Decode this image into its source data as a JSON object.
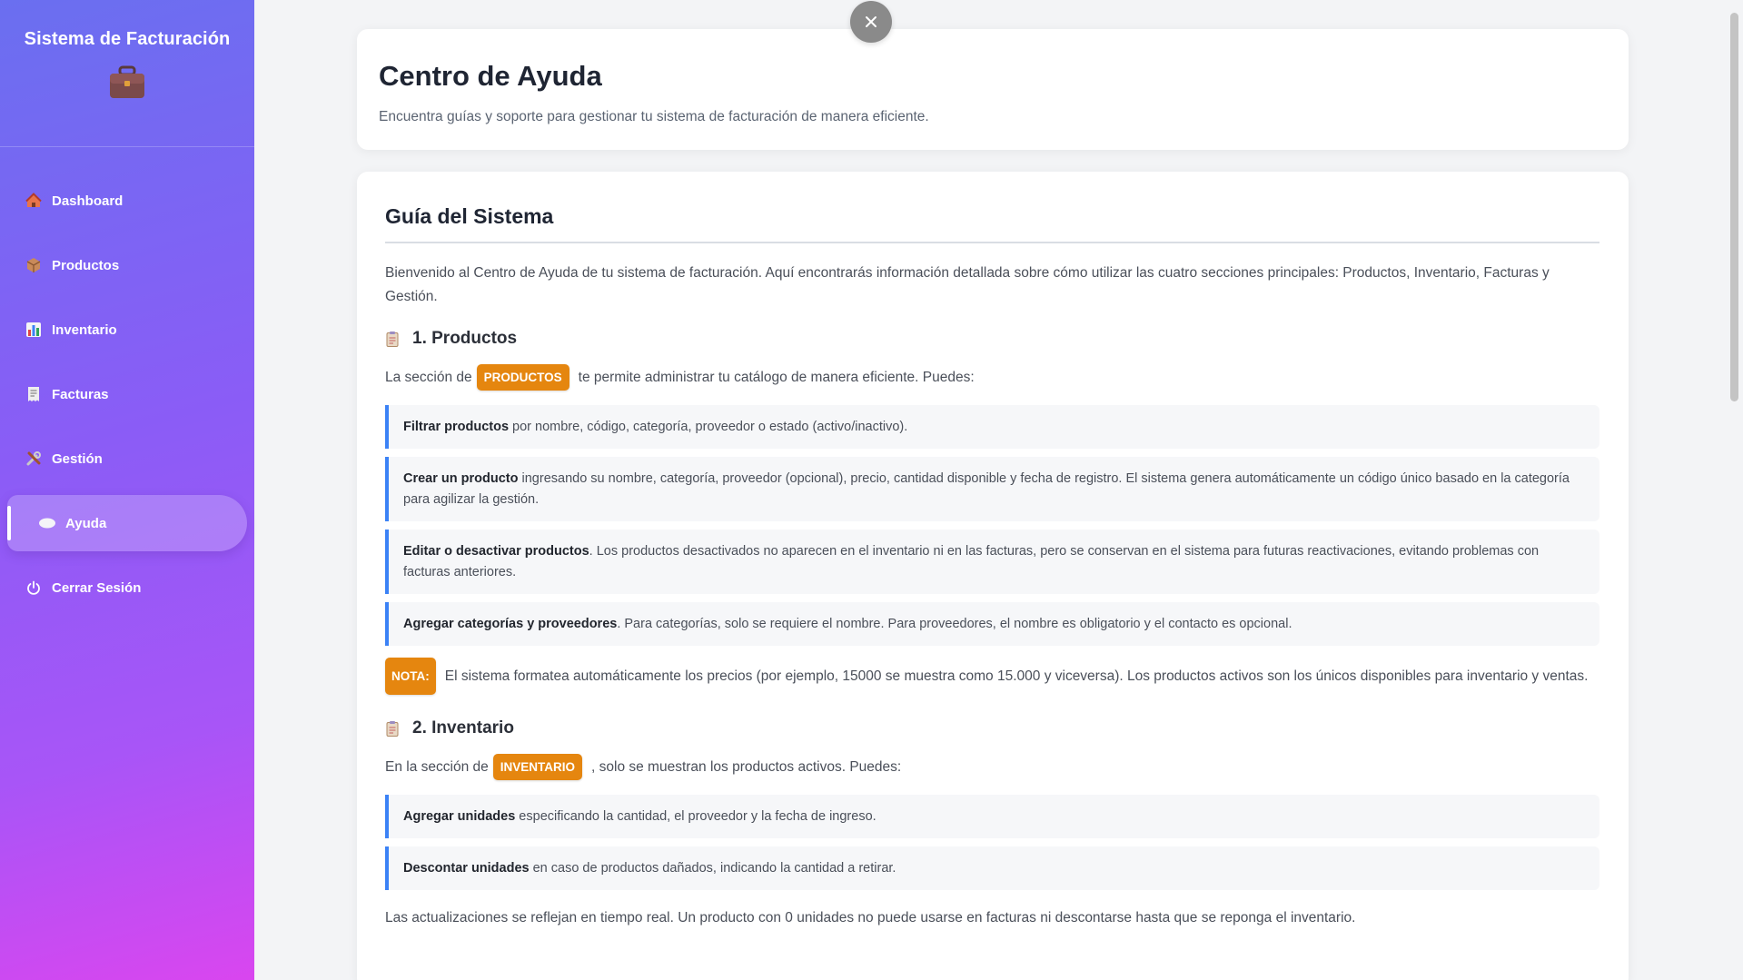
{
  "sidebar": {
    "brand": "Sistema de Facturación",
    "brand_icon": "briefcase-icon",
    "items": [
      {
        "label": "Dashboard",
        "icon": "house-icon"
      },
      {
        "label": "Productos",
        "icon": "package-icon"
      },
      {
        "label": "Inventario",
        "icon": "bar-chart-icon"
      },
      {
        "label": "Facturas",
        "icon": "receipt-icon"
      },
      {
        "label": "Gestión",
        "icon": "tools-icon"
      },
      {
        "label": "Ayuda",
        "icon": "help-bubble-icon",
        "active": true
      },
      {
        "label": "Cerrar Sesión",
        "icon": "power-icon"
      }
    ]
  },
  "header": {
    "title": "Centro de Ayuda",
    "subtitle": "Encuentra guías y soporte para gestionar tu sistema de facturación de manera eficiente."
  },
  "guide": {
    "title": "Guía del Sistema",
    "intro": "Bienvenido al Centro de Ayuda de tu sistema de facturación. Aquí encontrarás información detallada sobre cómo utilizar las cuatro secciones principales: Productos, Inventario, Facturas y Gestión.",
    "productos": {
      "heading": "1. Productos",
      "lead_before": "La sección de",
      "tag": "PRODUCTOS",
      "lead_after": "te permite administrar tu catálogo de manera eficiente. Puedes:",
      "items": [
        {
          "bold": "Filtrar productos",
          "text": " por nombre, código, categoría, proveedor o estado (activo/inactivo)."
        },
        {
          "bold": "Crear un producto",
          "text": " ingresando su nombre, categoría, proveedor (opcional), precio, cantidad disponible y fecha de registro. El sistema genera automáticamente un código único basado en la categoría para agilizar la gestión."
        },
        {
          "bold": "Editar o desactivar productos",
          "text": ". Los productos desactivados no aparecen en el inventario ni en las facturas, pero se conservan en el sistema para futuras reactivaciones, evitando problemas con facturas anteriores."
        },
        {
          "bold": "Agregar categorías y proveedores",
          "text": ". Para categorías, solo se requiere el nombre. Para proveedores, el nombre es obligatorio y el contacto es opcional."
        }
      ],
      "note_tag": "NOTA:",
      "note": "El sistema formatea automáticamente los precios (por ejemplo, 15000 se muestra como 15.000 y viceversa). Los productos activos son los únicos disponibles para inventario y ventas."
    },
    "inventario": {
      "heading": "2. Inventario",
      "lead_before": "En la sección de",
      "tag": "INVENTARIO",
      "lead_after": ", solo se muestran los productos activos. Puedes:",
      "items": [
        {
          "bold": "Agregar unidades",
          "text": " especificando la cantidad, el proveedor y la fecha de ingreso."
        },
        {
          "bold": "Descontar unidades",
          "text": " en caso de productos dañados, indicando la cantidad a retirar."
        }
      ],
      "footer": "Las actualizaciones se reflejan en tiempo real. Un producto con 0 unidades no puede usarse en facturas ni descontarse hasta que se reponga el inventario."
    }
  },
  "colors": {
    "accent_blue": "#3b82f6",
    "tag_orange": "#e5860f",
    "sidebar_top": "#6a6ff0",
    "sidebar_bottom": "#d946ef"
  }
}
